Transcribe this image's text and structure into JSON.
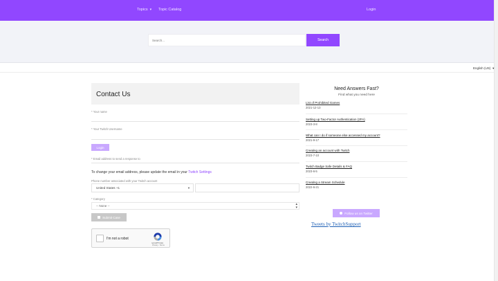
{
  "nav": {
    "topics": "Topics",
    "topic_catalog": "Topic Catalog",
    "login": "Login"
  },
  "search": {
    "placeholder": "Search...",
    "button": "Search"
  },
  "language": {
    "selected": "English (US)"
  },
  "form": {
    "title": "Contact Us",
    "your_name_label": "* Your name",
    "twitch_username_label": "* Your Twitch Username",
    "login_button": "Login",
    "email_note": "* Email address to send a response to",
    "change_email_text": "To change your email address, please update the email in your",
    "twitch_settings_link": "Twitch Settings",
    "phone_label": "Phone number associated with your Twitch account",
    "phone_country": "United States +1",
    "category_label": "* Category",
    "category_value": "-- None --",
    "submit_button": "Submit Case",
    "recaptcha": {
      "label": "I'm not a robot",
      "brand": "reCAPTCHA",
      "terms": "Privacy - Terms"
    }
  },
  "sidebar": {
    "title": "Need Answers Fast?",
    "subtitle": "Find what you need here",
    "articles": [
      {
        "title": "List of Prohibited Games",
        "date": "2021-12-13"
      },
      {
        "title": "Setting up Two-Factor Authentication (2FA)",
        "date": "2023-3-8"
      },
      {
        "title": "What can I do if someone else accessed my account?",
        "date": "2021-9-17"
      },
      {
        "title": "Creating an account with Twitch",
        "date": "2023-7-10"
      },
      {
        "title": "Twitch Badge Safe Details & FAQ",
        "date": "2023-6-5"
      },
      {
        "title": "Creating a Stream Schedule",
        "date": "2022-6-21"
      }
    ],
    "twitter_button": "Follow us on Twitter",
    "tweets_link": "Tweets by TwitchSupport"
  },
  "colors": {
    "brand": "#9147ff",
    "brand_light": "#c9a8ff",
    "link": "#1d5fb5"
  }
}
